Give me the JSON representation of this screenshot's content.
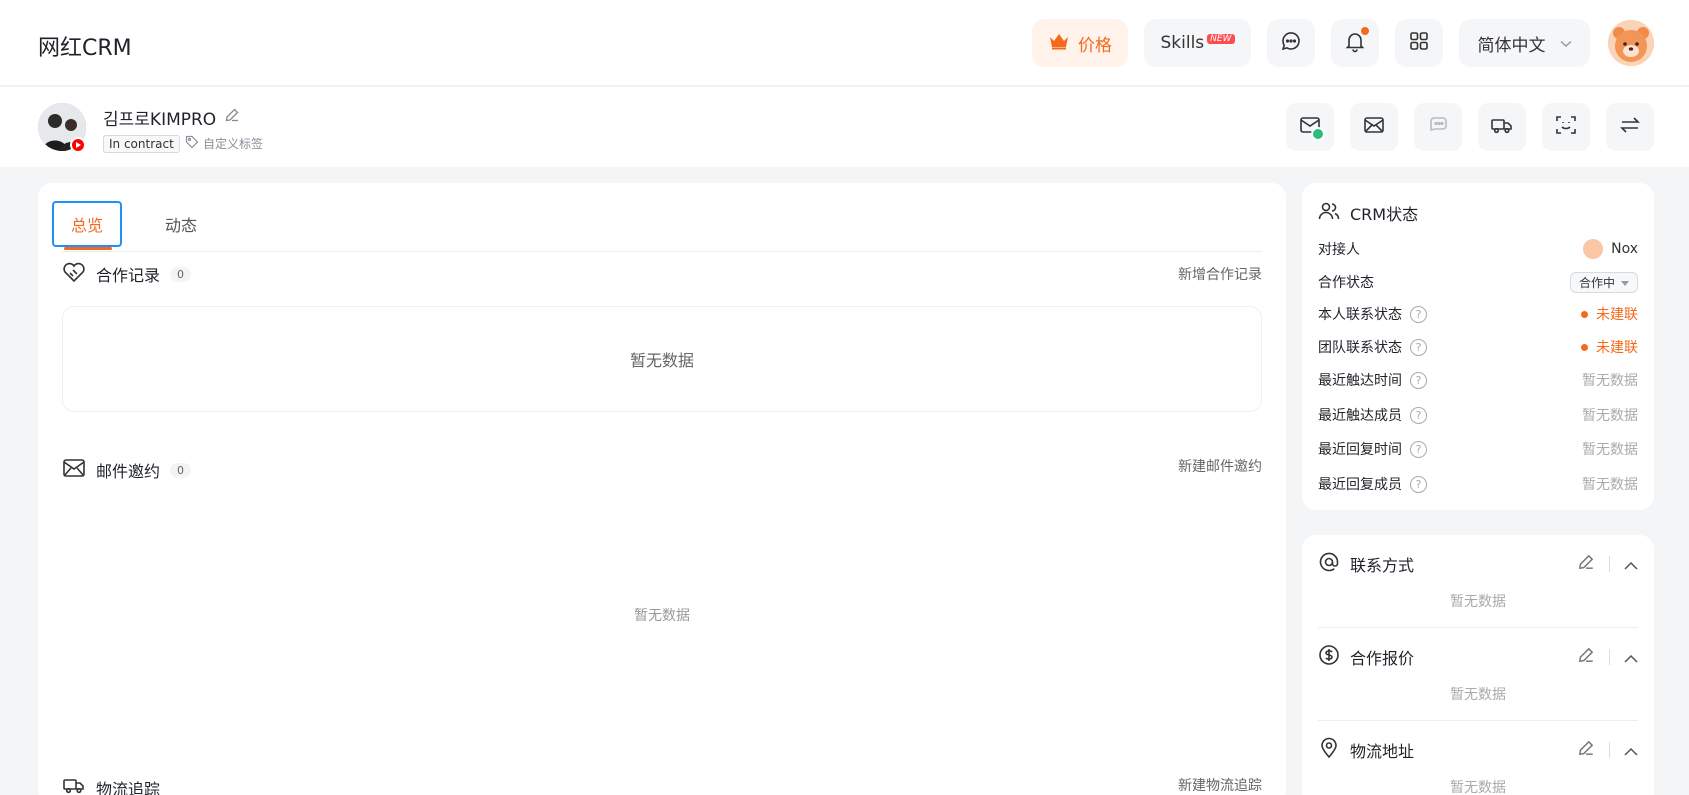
{
  "header": {
    "app_title": "网红CRM",
    "price_label": "价格",
    "skills_label": "Skills",
    "skills_badge": "NEW",
    "language": "简体中文"
  },
  "profile": {
    "name": "김프로KIMPRO",
    "status_tag": "In contract",
    "custom_tag_label": "自定义标签"
  },
  "tabs": [
    {
      "label": "总览",
      "active": true
    },
    {
      "label": "动态",
      "active": false
    }
  ],
  "sections": {
    "cooperation": {
      "title": "合作记录",
      "count": "0",
      "action": "新增合作记录",
      "empty": "暂无数据"
    },
    "email": {
      "title": "邮件邀约",
      "count": "0",
      "action": "新建邮件邀约",
      "empty": "暂无数据"
    },
    "logistics": {
      "title": "物流追踪",
      "action": "新建物流追踪"
    }
  },
  "crm_status": {
    "title": "CRM状态",
    "rows": [
      {
        "label": "对接人",
        "value": "Nox"
      },
      {
        "label": "合作状态",
        "value": "合作中"
      },
      {
        "label": "本人联系状态",
        "value": "未建联"
      },
      {
        "label": "团队联系状态",
        "value": "未建联"
      },
      {
        "label": "最近触达时间",
        "value": "暂无数据"
      },
      {
        "label": "最近触达成员",
        "value": "暂无数据"
      },
      {
        "label": "最近回复时间",
        "value": "暂无数据"
      },
      {
        "label": "最近回复成员",
        "value": "暂无数据"
      }
    ]
  },
  "info_sections": [
    {
      "title": "联系方式",
      "empty": "暂无数据"
    },
    {
      "title": "合作报价",
      "empty": "暂无数据"
    },
    {
      "title": "物流地址",
      "empty": "暂无数据"
    }
  ],
  "colors": {
    "accent": "#f46a1c",
    "focus_outline": "#1e90ff",
    "success": "#2bbd7e"
  }
}
